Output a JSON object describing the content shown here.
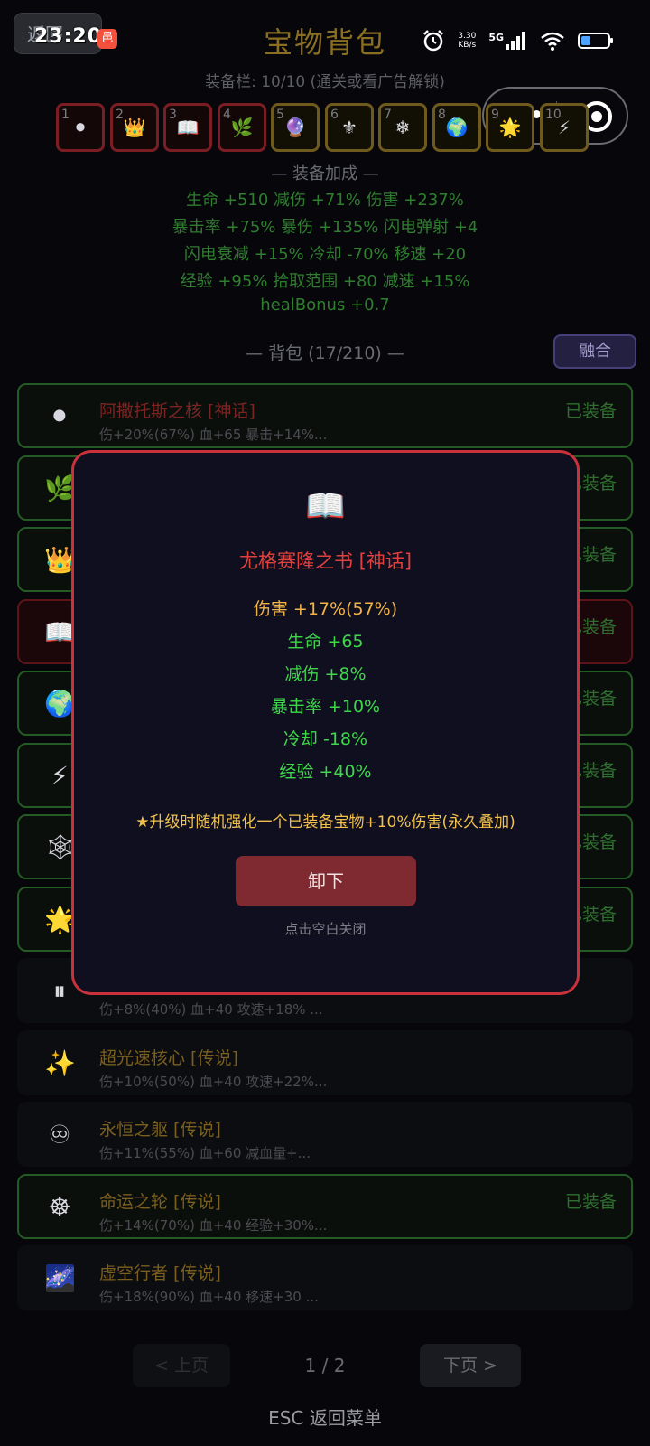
{
  "status": {
    "time": "23:20",
    "back_label": "返回",
    "app_badge": "邑",
    "net_speed_value": "3.30",
    "net_speed_unit": "KB/s",
    "signal_label": "5G"
  },
  "header": {
    "title": "宝物背包"
  },
  "equip_bar": {
    "label": "装备栏: 10/10 (通关或看广告解锁)"
  },
  "slots": [
    {
      "num": "1",
      "icon": "⚫",
      "icon_name": "orb-icon"
    },
    {
      "num": "2",
      "icon": "👑",
      "icon_name": "crown-icon"
    },
    {
      "num": "3",
      "icon": "📖",
      "icon_name": "book-icon"
    },
    {
      "num": "4",
      "icon": "🌿",
      "icon_name": "herb-icon"
    },
    {
      "num": "5",
      "icon": "🔮",
      "icon_name": "crystal-icon"
    },
    {
      "num": "6",
      "icon": "⚜",
      "icon_name": "fleur-icon"
    },
    {
      "num": "7",
      "icon": "❄",
      "icon_name": "snowflake-icon"
    },
    {
      "num": "8",
      "icon": "🌍",
      "icon_name": "globe-icon"
    },
    {
      "num": "9",
      "icon": "🌟",
      "icon_name": "star-burst-icon"
    },
    {
      "num": "10",
      "icon": "⚡",
      "icon_name": "lightning-icon"
    }
  ],
  "bonus": {
    "title": "— 装备加成 —",
    "lines": [
      "生命 +510  减伤 +71%  伤害 +237%",
      "暴击率 +75%  暴伤 +135%  闪电弹射 +4",
      "闪电衰减 +15%  冷却 -70%  移速 +20",
      "经验 +95%  拾取范围 +80  减速 +15%",
      "healBonus +0.7"
    ]
  },
  "backpack": {
    "title": "— 背包 (17/210) —",
    "fuse_label": "融合"
  },
  "items": [
    {
      "icon": "⚫",
      "icon_name": "orb-icon",
      "name": "阿撒托斯之核 [神话]",
      "desc": "伤+20%(67%) 血+65 暴击+14%...",
      "state": "已装备",
      "equipped": true,
      "myth": true,
      "selected": false
    },
    {
      "icon": "🌿",
      "icon_name": "herb-icon",
      "name": "",
      "desc": "",
      "state": "已装备",
      "equipped": true,
      "myth": false,
      "selected": false
    },
    {
      "icon": "👑",
      "icon_name": "crown-icon",
      "name": "",
      "desc": "",
      "state": "已装备",
      "equipped": true,
      "myth": false,
      "selected": false
    },
    {
      "icon": "📖",
      "icon_name": "book-icon",
      "name": "",
      "desc": "",
      "state": "已装备",
      "equipped": true,
      "myth": false,
      "selected": true
    },
    {
      "icon": "🌍",
      "icon_name": "globe-icon",
      "name": "",
      "desc": "",
      "state": "已装备",
      "equipped": true,
      "myth": false,
      "selected": false
    },
    {
      "icon": "⚡",
      "icon_name": "lightning-icon",
      "name": "",
      "desc": "",
      "state": "已装备",
      "equipped": true,
      "myth": false,
      "selected": false
    },
    {
      "icon": "🕸",
      "icon_name": "web-icon",
      "name": "",
      "desc": "",
      "state": "已装备",
      "equipped": true,
      "myth": false,
      "selected": false
    },
    {
      "icon": "🌟",
      "icon_name": "star-burst-icon",
      "name": "",
      "desc": "",
      "state": "已装备",
      "equipped": true,
      "myth": false,
      "selected": false
    },
    {
      "icon": "⏸",
      "icon_name": "pause-icon",
      "name": "",
      "desc": "伤+8%(40%) 血+40 攻速+18% ...",
      "state": "",
      "equipped": false,
      "myth": false,
      "selected": false
    },
    {
      "icon": "✨",
      "icon_name": "sparkles-icon",
      "name": "超光速核心 [传说]",
      "desc": "伤+10%(50%) 血+40 攻速+22%...",
      "state": "",
      "equipped": false,
      "myth": false,
      "selected": false
    },
    {
      "icon": "♾",
      "icon_name": "infinity-icon",
      "name": "永恒之躯 [传说]",
      "desc": "伤+11%(55%) 血+60 减血量+...",
      "state": "",
      "equipped": false,
      "myth": false,
      "selected": false
    },
    {
      "icon": "☸",
      "icon_name": "wheel-icon",
      "name": "命运之轮 [传说]",
      "desc": "伤+14%(70%) 血+40 经验+30%...",
      "state": "已装备",
      "equipped": true,
      "myth": false,
      "selected": false
    },
    {
      "icon": "🌌",
      "icon_name": "galaxy-icon",
      "name": "虚空行者 [传说]",
      "desc": "伤+18%(90%) 血+40 移速+30 ...",
      "state": "",
      "equipped": false,
      "myth": false,
      "selected": false
    }
  ],
  "pager": {
    "prev_label": "< 上页",
    "page_text": "1 / 2",
    "next_label": "下页 >"
  },
  "footer": {
    "esc_hint": "ESC 返回菜单"
  },
  "modal": {
    "icon": "📖",
    "icon_name": "book-icon",
    "title": "尤格赛隆之书 [神话]",
    "stats": [
      "伤害 +17%(57%)",
      "生命 +65",
      "减伤 +8%",
      "暴击率 +10%",
      "冷却 -18%",
      "经验 +40%"
    ],
    "special": "★升级时随机强化一个已装备宝物+10%伤害(永久叠加)",
    "unequip_label": "卸下",
    "close_hint": "点击空白关闭"
  }
}
